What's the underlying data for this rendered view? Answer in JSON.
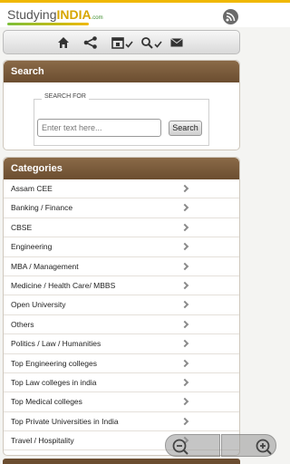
{
  "header": {
    "logo_text_main": "Studying",
    "logo_text_brand": "INDIA",
    "logo_text_suffix": ".com",
    "rss_icon": "rss-icon"
  },
  "toolbar": {
    "icons": [
      "home-icon",
      "share-icon",
      "calendar-check-icon",
      "search-check-icon",
      "mail-icon"
    ]
  },
  "search": {
    "title": "Search",
    "legend": "SEARCH FOR",
    "placeholder": "Enter text here...",
    "button_label": "Search"
  },
  "categories": {
    "title": "Categories",
    "items": [
      {
        "label": "Assam CEE"
      },
      {
        "label": "Banking / Finance"
      },
      {
        "label": "CBSE"
      },
      {
        "label": "Engineering"
      },
      {
        "label": "MBA / Management"
      },
      {
        "label": "Medicine / Health Care/ MBBS"
      },
      {
        "label": "Open University"
      },
      {
        "label": "Others"
      },
      {
        "label": "Politics / Law / Humanities"
      },
      {
        "label": "Top Engineering colleges"
      },
      {
        "label": "Top Law colleges in india"
      },
      {
        "label": "Top Medical colleges"
      },
      {
        "label": "Top Private Universities in India"
      },
      {
        "label": "Travel / Hospitality"
      }
    ]
  },
  "zoom": {
    "out_icon": "zoom-out-icon",
    "in_icon": "zoom-in-icon"
  },
  "colors": {
    "accent_brown": "#7a5a3a",
    "brand_gold": "#f0b800"
  }
}
